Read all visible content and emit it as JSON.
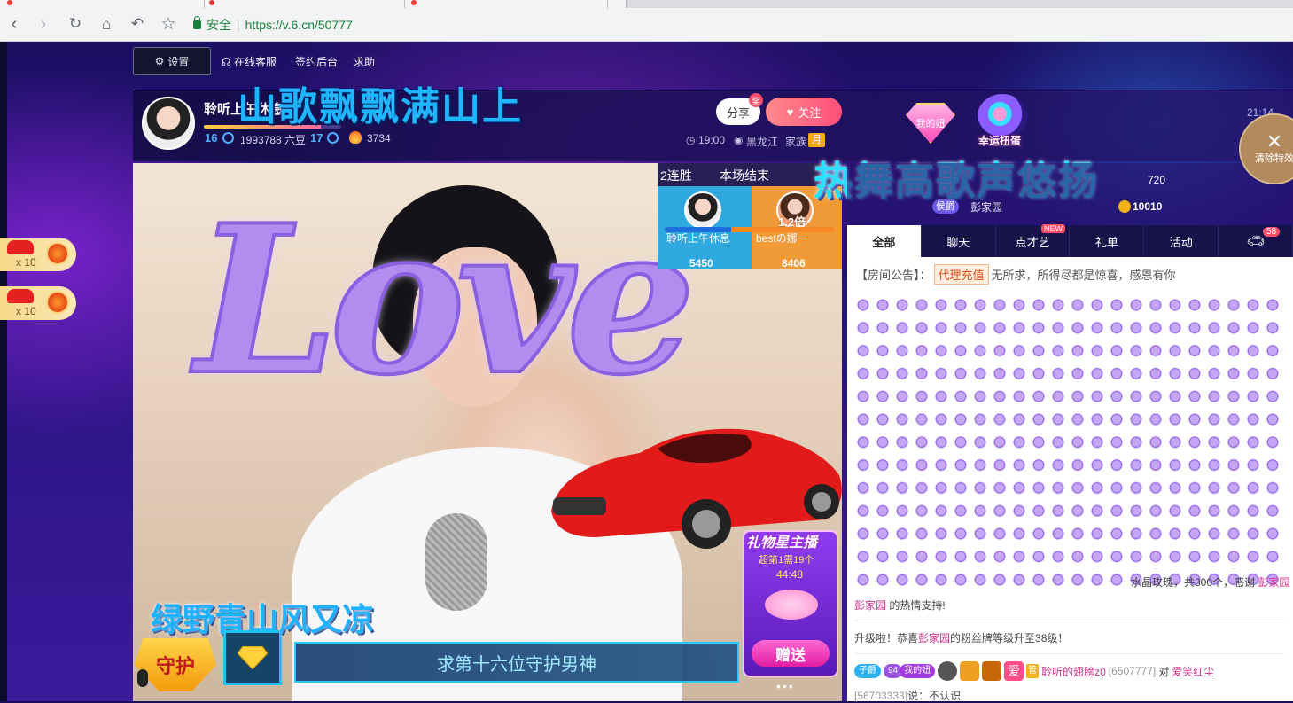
{
  "browser": {
    "secure_label": "安全",
    "url": "https://v.6.cn/50777"
  },
  "topnav": {
    "settings": "设置",
    "service": "在线客服",
    "sign": "签约后台",
    "help": "求助"
  },
  "anchor": {
    "name": "聆听上午休息",
    "level_left": "16",
    "level_right": "17",
    "beans": "1993788 六豆",
    "popularity": "3734",
    "level_progress": 0.85,
    "time": "19:00",
    "region": "黑龙江",
    "family_label": "家族",
    "family_badge": "月"
  },
  "buttons": {
    "share": "分享",
    "share_badge": "奖",
    "follow": "关注",
    "my_fav": "我的妞",
    "lucky_egg": "幸运扭蛋",
    "clear_fx": "清除特效",
    "send": "赠送"
  },
  "clock": "21:14",
  "banners": {
    "song": "山歌飘飘满山上",
    "dance": "热舞高歌声悠扬",
    "mountain": "绿野青山风又凉",
    "guard_request": "求第十六位守护男神",
    "guard_badge": "守护"
  },
  "gift_badges": [
    {
      "mult": "x 10"
    },
    {
      "mult": "x 10"
    }
  ],
  "pk": {
    "streak": "2连胜",
    "status": "本场结束",
    "left_name": "聆听上午休息",
    "right_name": "bestの娜一",
    "multiplier": "1.2倍",
    "left_score": "5450",
    "right_score": "8406",
    "left_share": 0.39
  },
  "gift_star": {
    "title": "礼物星主播",
    "subtitle": "超第1需19个",
    "countdown": "44:48"
  },
  "rank": {
    "value1": "720",
    "badge": "侯爵",
    "user": "彭家园",
    "value2": "10010"
  },
  "tabs": [
    "全部",
    "聊天",
    "点才艺",
    "礼单",
    "活动"
  ],
  "tab_new_badge": "NEW",
  "car_count": "58",
  "chat": {
    "notice_prefix": "【房间公告】：",
    "notice_tag": "代理充值",
    "notice_text": "无所求，所得尽都是惊喜，感恩有你",
    "rose_text": "水晶玫瑰，共300个，感谢",
    "rose_user": "彭家园",
    "rose_tail": "的热情支持!",
    "upgrade_prefix": "升级啦！恭喜",
    "upgrade_user": "彭家园",
    "upgrade_suffix": "的粉丝牌等级升至38级！",
    "line_badge_zi": "子爵",
    "line_badge_fav": "我的妞",
    "line_badge_fav_num": "94",
    "line_badge_love": "爱",
    "line_badge_guan": "管",
    "line_user": "聆听的翅膀z0",
    "line_uid": "[6507777]",
    "line_to": "对",
    "line_target": "爱笑红尘",
    "line_target_uid": "[56703333]",
    "line_said": "说：不认识"
  },
  "colors": {
    "accent_blue": "#1fb6ff",
    "follow_pink": "#ff4f7a",
    "page_bg": "#1b0f63",
    "username_pink": "#d2358f"
  }
}
